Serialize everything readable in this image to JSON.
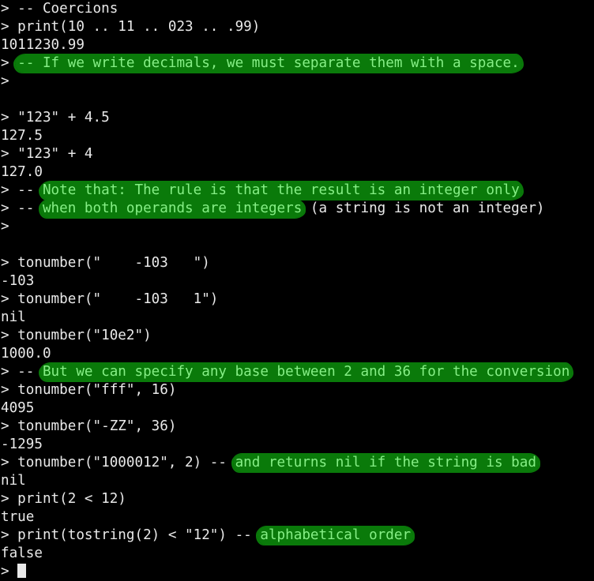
{
  "terminal": {
    "title": "Lua interactive interpreter session",
    "colors": {
      "background": "#000000",
      "text": "#e9e9e9",
      "highlight_background": "#0a7a0a",
      "highlight_text": "#86ef86",
      "cursor": "#e9e9e9"
    },
    "prompt": "> ",
    "cursor_glyph": "block",
    "lines": [
      {
        "plain": "> -- Coercions"
      },
      {
        "plain": "> print(10 .. 11 .. 023 .. .99)"
      },
      {
        "plain": "1011230.99"
      },
      {
        "pre": "> ",
        "hl": "-- If we write decimals, we must separate them with a space.",
        "post": ""
      },
      {
        "plain": ">"
      },
      {
        "plain": ""
      },
      {
        "plain": "> \"123\" + 4.5"
      },
      {
        "plain": "127.5"
      },
      {
        "plain": "> \"123\" + 4"
      },
      {
        "plain": "127.0"
      },
      {
        "pre": "> -- ",
        "hl": "Note that: The rule is that the result is an integer only",
        "post": ""
      },
      {
        "pre": "> -- ",
        "hl": "when both operands are integers",
        "post": " (a string is not an integer)"
      },
      {
        "plain": ">"
      },
      {
        "plain": ""
      },
      {
        "plain": "> tonumber(\"    -103   \")"
      },
      {
        "plain": "-103"
      },
      {
        "plain": "> tonumber(\"    -103   1\")"
      },
      {
        "plain": "nil"
      },
      {
        "plain": "> tonumber(\"10e2\")"
      },
      {
        "plain": "1000.0"
      },
      {
        "pre": "> -- ",
        "hl": "But we can specify any base between 2 and 36 for the conversion",
        "post": ""
      },
      {
        "plain": "> tonumber(\"fff\", 16)"
      },
      {
        "plain": "4095"
      },
      {
        "plain": "> tonumber(\"-ZZ\", 36)"
      },
      {
        "plain": "-1295"
      },
      {
        "pre": "> tonumber(\"1000012\", 2) -- ",
        "hl": "and returns nil if the string is bad",
        "post": ""
      },
      {
        "plain": "nil"
      },
      {
        "plain": "> print(2 < 12)"
      },
      {
        "plain": "true"
      },
      {
        "pre": "> print(tostring(2) < \"12\") -- ",
        "hl": "alphabetical order",
        "post": ""
      },
      {
        "plain": "false"
      },
      {
        "prompt_cursor": "> "
      }
    ]
  }
}
